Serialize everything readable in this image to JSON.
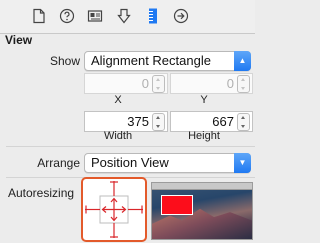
{
  "toolbar": {
    "icons": [
      "file-inspector-icon",
      "quick-help-icon",
      "identity-inspector-icon",
      "attributes-inspector-icon",
      "size-inspector-icon",
      "connections-inspector-icon"
    ]
  },
  "section": {
    "title": "View"
  },
  "show": {
    "label": "Show",
    "value": "Alignment Rectangle"
  },
  "position": {
    "x_value": "0",
    "y_value": "0",
    "x_caption": "X",
    "y_caption": "Y"
  },
  "size": {
    "width_value": "375",
    "height_value": "667",
    "width_caption": "Width",
    "height_caption": "Height"
  },
  "arrange": {
    "label": "Arrange",
    "value": "Position View"
  },
  "autoresizing": {
    "label": "Autoresizing"
  },
  "colors": {
    "accent": "#1f79f2",
    "highlight": "#e35a2b",
    "strut": "#d9262a",
    "preview_box": "#fc0d1b"
  }
}
